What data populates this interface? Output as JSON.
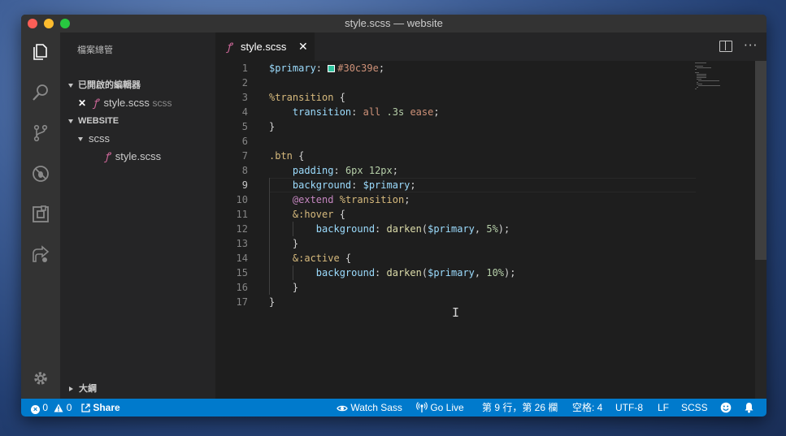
{
  "window": {
    "title": "style.scss — website"
  },
  "sidebar": {
    "title": "檔案總管",
    "open_editors_label": "已開啟的編輯器",
    "open_editor_file": "style.scss",
    "open_editor_lang": "scss",
    "workspace_label": "WEBSITE",
    "folder": "scss",
    "file": "style.scss",
    "outline_label": "大綱"
  },
  "tab": {
    "label": "style.scss",
    "close": "✕"
  },
  "editor": {
    "line_numbers": [
      "1",
      "2",
      "3",
      "4",
      "5",
      "6",
      "7",
      "8",
      "9",
      "10",
      "11",
      "12",
      "13",
      "14",
      "15",
      "16",
      "17"
    ],
    "active_line": 9,
    "hex_color": "#30c39e",
    "lines": [
      [
        [
          "c-var",
          "$primary"
        ],
        [
          "",
          ": "
        ],
        [
          "swatch",
          ""
        ],
        [
          "c-hex",
          "#30c39e"
        ],
        [
          "",
          ";"
        ]
      ],
      [],
      [
        [
          "c-sel",
          "%transition"
        ],
        [
          "",
          " {"
        ]
      ],
      [
        [
          "",
          "    "
        ],
        [
          "c-var",
          "transition"
        ],
        [
          "",
          ": "
        ],
        [
          "c-str",
          "all"
        ],
        [
          "",
          " "
        ],
        [
          "c-num",
          ".3s"
        ],
        [
          "",
          " "
        ],
        [
          "c-str",
          "ease"
        ],
        [
          "",
          ";"
        ]
      ],
      [
        [
          "",
          "}"
        ]
      ],
      [],
      [
        [
          "c-sel",
          ".btn"
        ],
        [
          "",
          " {"
        ]
      ],
      [
        [
          "",
          "    "
        ],
        [
          "c-var",
          "padding"
        ],
        [
          "",
          ": "
        ],
        [
          "c-num",
          "6px"
        ],
        [
          "",
          " "
        ],
        [
          "c-num",
          "12px"
        ],
        [
          "",
          ";"
        ]
      ],
      [
        [
          "",
          "    "
        ],
        [
          "c-var",
          "background"
        ],
        [
          "",
          ": "
        ],
        [
          "c-var",
          "$primary"
        ],
        [
          "",
          ";"
        ]
      ],
      [
        [
          "",
          "    "
        ],
        [
          "c-kw",
          "@extend"
        ],
        [
          "",
          " "
        ],
        [
          "c-sel",
          "%transition"
        ],
        [
          "",
          ";"
        ]
      ],
      [
        [
          "",
          "    "
        ],
        [
          "c-sel",
          "&:hover"
        ],
        [
          "",
          " {"
        ]
      ],
      [
        [
          "",
          "        "
        ],
        [
          "c-var",
          "background"
        ],
        [
          "",
          ": "
        ],
        [
          "c-fn",
          "darken"
        ],
        [
          "",
          "("
        ],
        [
          "c-var",
          "$primary"
        ],
        [
          "",
          ", "
        ],
        [
          "c-num",
          "5%"
        ],
        [
          "",
          ");"
        ]
      ],
      [
        [
          "",
          "    }"
        ]
      ],
      [
        [
          "",
          "    "
        ],
        [
          "c-sel",
          "&:active"
        ],
        [
          "",
          " {"
        ]
      ],
      [
        [
          "",
          "        "
        ],
        [
          "c-var",
          "background"
        ],
        [
          "",
          ": "
        ],
        [
          "c-fn",
          "darken"
        ],
        [
          "",
          "("
        ],
        [
          "c-var",
          "$primary"
        ],
        [
          "",
          ", "
        ],
        [
          "c-num",
          "10%"
        ],
        [
          "",
          ");"
        ]
      ],
      [
        [
          "",
          "    }"
        ]
      ],
      [
        [
          "",
          "}"
        ]
      ]
    ]
  },
  "statusbar": {
    "errors": "0",
    "warnings": "0",
    "share": "Share",
    "watch_sass": "Watch Sass",
    "go_live": "Go Live",
    "position": "第 9 行，第 26 欄",
    "indent": "空格: 4",
    "encoding": "UTF-8",
    "eol": "LF",
    "language": "SCSS"
  },
  "colors": {
    "accent": "#007acc",
    "sass_pink": "#cd6799",
    "swatch": "#30c39e"
  },
  "icons": [
    "files-icon",
    "search-icon",
    "source-control-icon",
    "debug-icon",
    "extensions-icon",
    "live-share-icon",
    "gear-icon",
    "smiley-icon",
    "bell-icon",
    "split-editor-icon",
    "more-actions-icon"
  ]
}
